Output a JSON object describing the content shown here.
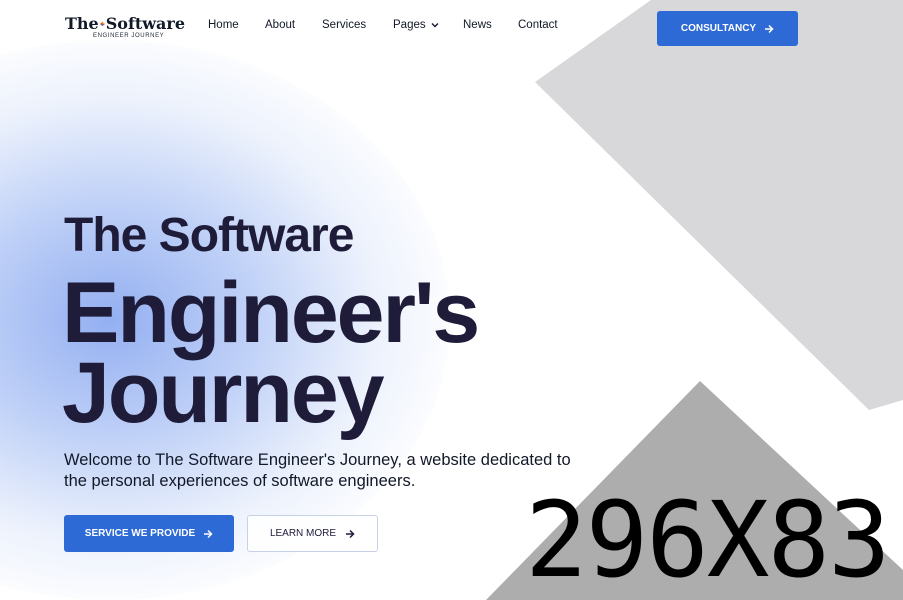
{
  "header": {
    "logo": {
      "title_prefix": "The",
      "title_suffix": "Software",
      "subtitle": "ENGINEER JOURNEY",
      "icon": "diamond-logo-icon"
    },
    "nav": [
      {
        "label": "Home"
      },
      {
        "label": "About"
      },
      {
        "label": "Services"
      },
      {
        "label": "Pages",
        "icon": "chevron-down-icon"
      },
      {
        "label": "News"
      },
      {
        "label": "Contact"
      }
    ],
    "cta": {
      "label": "CONSULTANCY",
      "icon": "arrow-right-icon"
    }
  },
  "hero": {
    "subtitle": "The Software",
    "title_line1": "Engineer's",
    "title_line2": "Journey",
    "description": "Welcome to The Software Engineer's Journey, a website dedicated to the personal experiences of software engineers.",
    "primary_button": "SERVICE WE PROVIDE",
    "secondary_button": "LEARN MORE"
  },
  "placeholder_image": {
    "label": "296X83"
  },
  "colors": {
    "accent": "#2d6ad6",
    "heading": "#1f1c3a",
    "shape_light": "#d8d8da",
    "shape_dark": "#adadad"
  }
}
